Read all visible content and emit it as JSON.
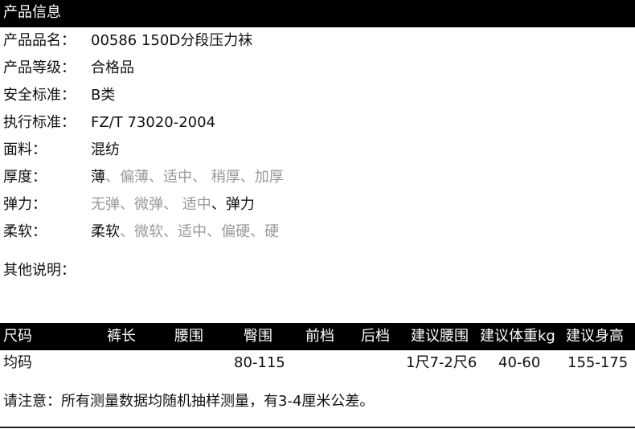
{
  "section": {
    "title": "产品信息"
  },
  "info": [
    {
      "label": "产品品名：",
      "value": "00586  150D分段压力袜"
    },
    {
      "label": "产品等级：",
      "value": "合格品"
    },
    {
      "label": "安全标准：",
      "value": "B类"
    },
    {
      "label": "执行标准：",
      "value": "FZ/T 73020-2004"
    },
    {
      "label": "面料：",
      "value": "混纺"
    }
  ],
  "thickness": {
    "label": "厚度：",
    "options": [
      "薄",
      "、偏薄",
      "、适中",
      "、 稍厚",
      "、加厚"
    ],
    "selected_index": 0
  },
  "elasticity": {
    "label": "弹力：",
    "options": [
      "无弹",
      "、微弹",
      "、 适中",
      "、弹力"
    ],
    "selected_index": 3
  },
  "softness": {
    "label": "柔软：",
    "options": [
      "柔软",
      "、微软",
      "、适中",
      "、偏硬",
      "、硬"
    ],
    "selected_index": 0
  },
  "notes": {
    "label": "其他说明："
  },
  "size_table": {
    "headers": [
      "尺码",
      "裤长",
      "腰围",
      "臀围",
      "前档",
      "后档",
      "建议腰围",
      "建议体重kg",
      "建议身高"
    ],
    "row": [
      "均码",
      "",
      "",
      "80-115",
      "",
      "",
      "1尺7-2尺6",
      "40-60",
      "155-175"
    ]
  },
  "footer": "请注意：所有测量数据均随机抽样测量，有3-4厘米公差。",
  "colors": {
    "bar": "#000000",
    "muted": "#999999"
  }
}
